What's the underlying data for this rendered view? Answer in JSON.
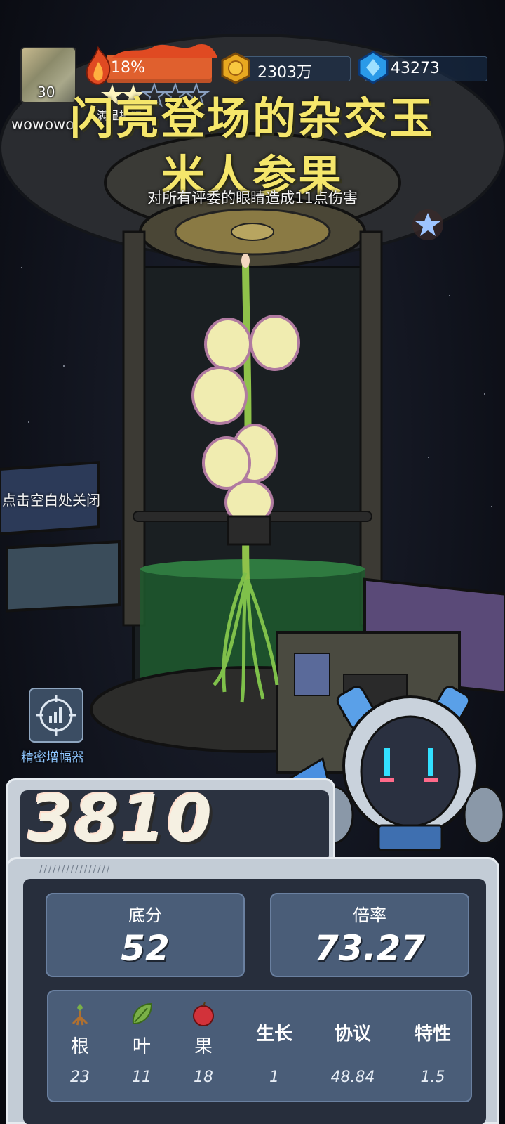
{
  "hud": {
    "level": "30",
    "username": "wowowo",
    "fire_percent": "18%",
    "lottery_label": "满星抽奖",
    "coins": "2303万",
    "gems": "43273"
  },
  "result": {
    "title_line1": "闪亮登场的杂交玉",
    "title_line2": "米人参果",
    "description": "对所有评委的眼睛造成11点伤害",
    "close_hint": "点击空白处关闭"
  },
  "amplifier": {
    "label": "精密增幅器",
    "icon": "target-chart-icon"
  },
  "score": {
    "total": "3810",
    "base_label": "底分",
    "base_value": "52",
    "rate_label": "倍率",
    "rate_value": "73.27"
  },
  "attributes": [
    {
      "name": "根",
      "value": "23",
      "icon": "root-icon"
    },
    {
      "name": "叶",
      "value": "11",
      "icon": "leaf-icon"
    },
    {
      "name": "果",
      "value": "18",
      "icon": "fruit-icon"
    },
    {
      "name": "生长",
      "value": "1"
    },
    {
      "name": "协议",
      "value": "48.84"
    },
    {
      "name": "特性",
      "value": "1.5"
    }
  ],
  "colors": {
    "title": "#f5e66b",
    "fire_bar": "#e0602e",
    "panel": "#4a5d78",
    "amp_label": "#8ec6ff"
  }
}
